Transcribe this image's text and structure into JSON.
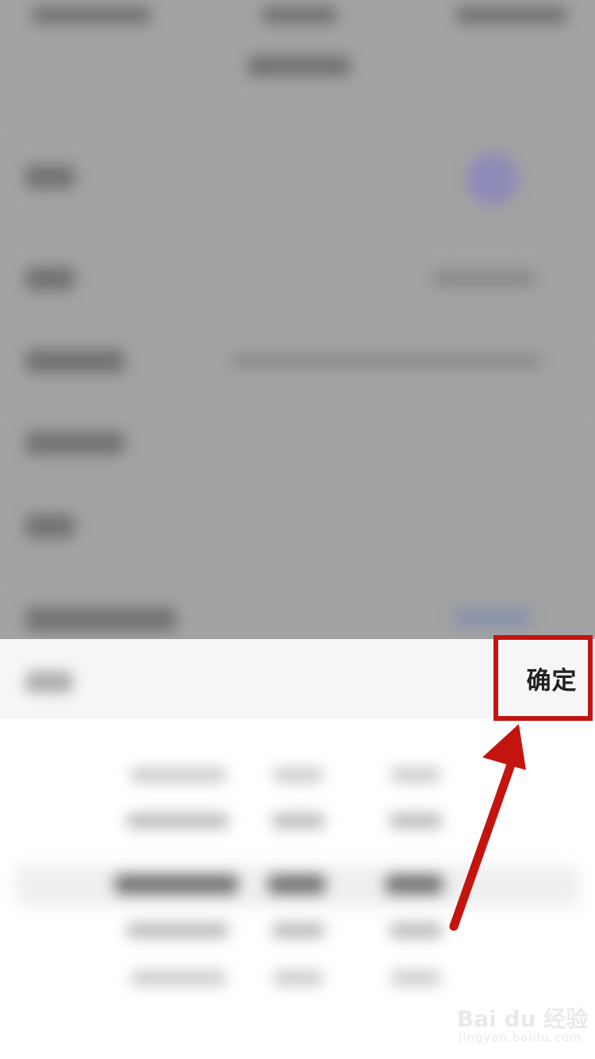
{
  "picker": {
    "confirm_label": "确定"
  },
  "watermark": {
    "brand": "Bai du 经验",
    "domain": "jingyan.baidu.com"
  },
  "colors": {
    "annotation": "#c4140f",
    "overlay": "#a3a3a3",
    "sheet_bg": "#ffffff"
  },
  "icons": {
    "annotation_arrow": "arrow-up-left-icon",
    "watermark_paw": "paw-icon"
  }
}
